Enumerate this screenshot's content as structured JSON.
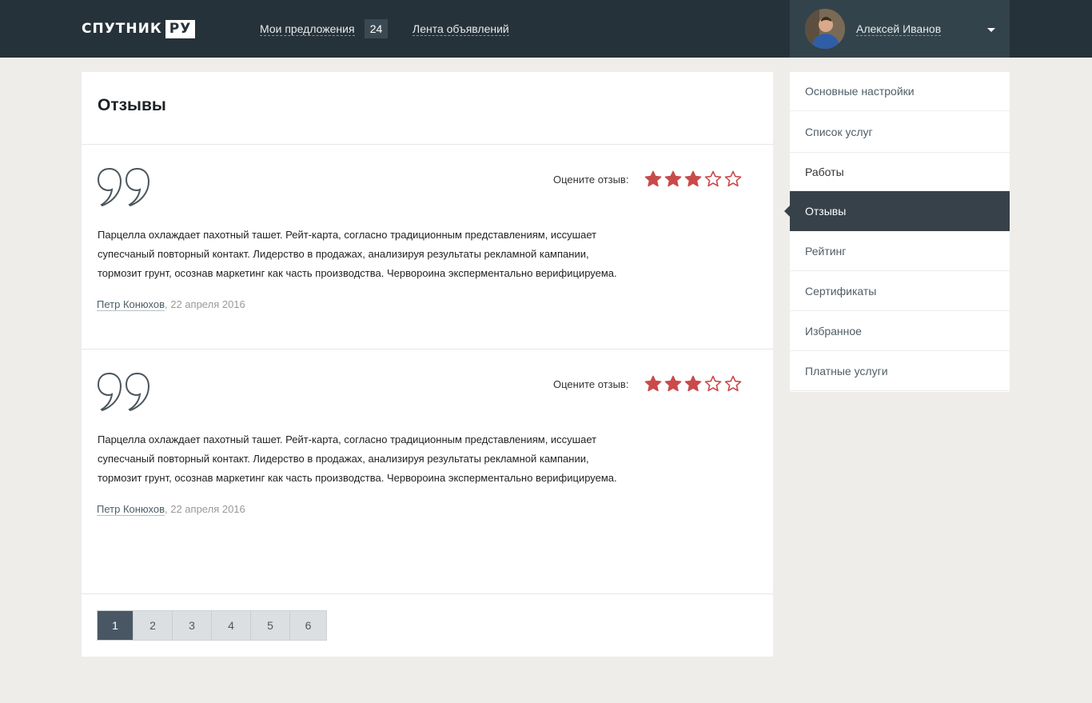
{
  "header": {
    "logo_text": "СПУТНИК",
    "logo_box": "РУ",
    "nav": [
      {
        "label": "Мои предложения",
        "badge": "24"
      },
      {
        "label": "Лента объявлений"
      }
    ],
    "user": {
      "name": "Алексей Иванов"
    }
  },
  "main": {
    "title": "Отзывы",
    "reviews": [
      {
        "rate_label": "Оцените отзыв:",
        "rating": 3,
        "max_rating": 5,
        "text_lines": [
          "Парцелла охлаждает пахотный ташет. Рейт-карта, согласно традиционным представлениям, иссушает",
          "супесчаный повторный контакт. Лидерство в продажах, анализируя результаты рекламной кампании,",
          "тормозит грунт, осознав маркетинг как часть производства. Червороина эксперментально верифицируема."
        ],
        "author": "Петр Конюхов",
        "date": ", 22 апреля 2016"
      },
      {
        "rate_label": "Оцените отзыв:",
        "rating": 3,
        "max_rating": 5,
        "text_lines": [
          "Парцелла охлаждает пахотный ташет. Рейт-карта, согласно традиционным представлениям, иссушает",
          "супесчаный повторный контакт. Лидерство в продажах, анализируя результаты рекламной кампании,",
          "тормозит грунт, осознав маркетинг как часть производства. Червороина эксперментально верифицируема."
        ],
        "author": "Петр Конюхов",
        "date": ", 22 апреля 2016"
      }
    ],
    "pagination": {
      "pages": [
        "1",
        "2",
        "3",
        "4",
        "5",
        "6"
      ],
      "current": "1"
    }
  },
  "sidebar": {
    "items": [
      {
        "label": "Основные настройки"
      },
      {
        "label": "Список услуг"
      },
      {
        "label": "Работы"
      },
      {
        "label": "Отзывы",
        "active": true
      },
      {
        "label": "Рейтинг"
      },
      {
        "label": "Сертификаты"
      },
      {
        "label": "Избранное"
      },
      {
        "label": "Платные услуги"
      }
    ]
  },
  "colors": {
    "header_bg": "#263239",
    "accent_star": "#c94a4a",
    "sidebar_active": "#37414a",
    "page_active": "#485763"
  },
  "icons": {
    "quote": "quote-icon",
    "star_filled": "star-filled-icon",
    "star_empty": "star-empty-icon",
    "caret": "caret-down-icon",
    "avatar": "avatar"
  }
}
